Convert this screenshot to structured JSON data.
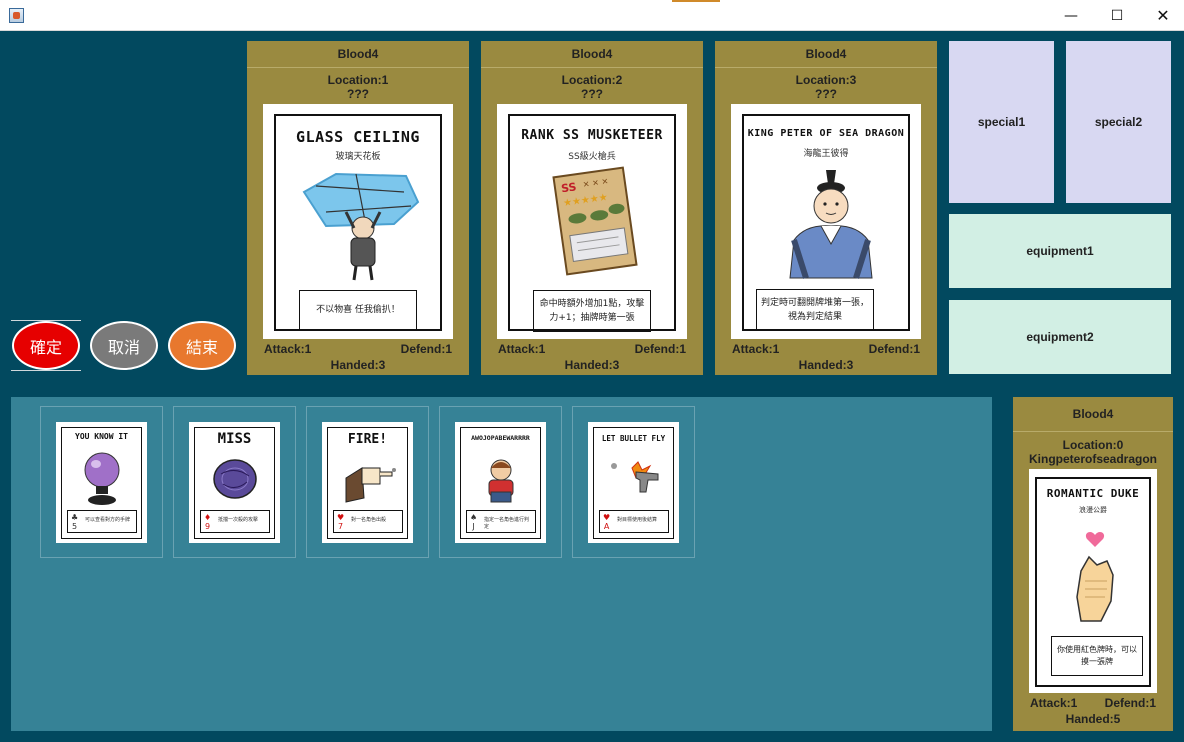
{
  "window": {
    "minimize_glyph": "—",
    "maximize_glyph": "☐",
    "close_glyph": "✕"
  },
  "opponents": [
    {
      "blood": "Blood4",
      "location": "Location:1",
      "identity": "???",
      "card": {
        "title": "GLASS CEILING",
        "subtitle": "玻璃天花板",
        "desc": "不以物喜 任我偷扒！"
      },
      "attack": "Attack:1",
      "defend": "Defend:1",
      "handed": "Handed:3"
    },
    {
      "blood": "Blood4",
      "location": "Location:2",
      "identity": "???",
      "card": {
        "title": "RANK SS MUSKETEER",
        "subtitle": "SS級火槍兵",
        "desc": "命中時額外增加1點，攻擊力+1；抽牌時第一張"
      },
      "attack": "Attack:1",
      "defend": "Defend:1",
      "handed": "Handed:3"
    },
    {
      "blood": "Blood4",
      "location": "Location:3",
      "identity": "???",
      "card": {
        "title": "KING PETER OF SEA DRAGON",
        "subtitle": "海龍王彼得",
        "desc": "判定時可翻開牌堆第一張，視為判定結果"
      },
      "attack": "Attack:1",
      "defend": "Defend:1",
      "handed": "Handed:3"
    }
  ],
  "slots": {
    "special1": "special1",
    "special2": "special2",
    "equipment1": "equipment1",
    "equipment2": "equipment2"
  },
  "actions": {
    "confirm": "確定",
    "cancel": "取消",
    "end": "結束"
  },
  "colors": {
    "background": "#02495f",
    "panel": "#9a8a40",
    "hand_area": "#368296",
    "confirm": "#e60000",
    "cancel": "#7a7a7a",
    "end": "#e8782e"
  },
  "hand": [
    {
      "title": "YOU KNOW IT",
      "suit": "♣",
      "rank": "5",
      "text": "可以查看對方的手牌",
      "image": "crystal-ball"
    },
    {
      "title": "MISS",
      "suit": "♦",
      "rank": "9",
      "text": "抵擋一次殺的攻擊",
      "image": "round-shield"
    },
    {
      "title": "FIRE!",
      "suit": "♥",
      "rank": "7",
      "text": "對一名角色出殺",
      "image": "pointing-hand"
    },
    {
      "title": "AWOJOPABEWARRRR",
      "suit": "♠",
      "rank": "J",
      "text": "指定一名角色進行判定",
      "image": "sad-boy"
    },
    {
      "title": "LET BULLET FLY",
      "suit": "♥",
      "rank": "A",
      "text": "對目標使用後結算",
      "image": "pistol"
    }
  ],
  "player": {
    "blood": "Blood4",
    "location": "Location:0",
    "character": "Kingpeterofseadragon",
    "card": {
      "title": "ROMANTIC DUKE",
      "subtitle": "浪漫公爵",
      "desc": "你使用紅色牌時，可以摸一張牌"
    },
    "attack": "Attack:1",
    "defend": "Defend:1",
    "handed": "Handed:5"
  }
}
